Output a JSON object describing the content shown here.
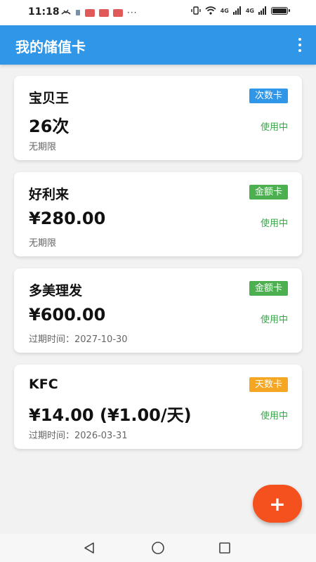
{
  "status_bar": {
    "time": "11:18",
    "left_icons": [
      "phone-missed-icon",
      "small-indicator-icon",
      "app-notification-icon",
      "app-notification-icon",
      "app-notification-icon"
    ],
    "overflow": "···",
    "network_1": "4G",
    "network_2": "4G",
    "battery_level": 0.9
  },
  "app_bar": {
    "title": "我的储值卡",
    "menu_icon": "more-vert-icon",
    "background_color": "#2f96e8"
  },
  "cards": [
    {
      "name": "宝贝王",
      "amount": "26次",
      "expiry": "无期限",
      "badge": "次数卡",
      "badge_color": "#2f96e8",
      "status": "使用中"
    },
    {
      "name": "好利来",
      "amount": "¥280.00",
      "expiry": "无期限",
      "badge": "金额卡",
      "badge_color": "#4caf50",
      "status": "使用中"
    },
    {
      "name": "多美理发",
      "amount": "¥600.00",
      "expiry": "过期时间：2027-10-30",
      "badge": "金额卡",
      "badge_color": "#4caf50",
      "status": "使用中"
    },
    {
      "name": "KFC",
      "amount": "¥14.00 (¥1.00/天)",
      "expiry": "过期时间：2026-03-31",
      "badge": "天数卡",
      "badge_color": "#f5a623",
      "status": "使用中"
    }
  ],
  "fab": {
    "label": "+",
    "icon": "add-icon",
    "color": "#f4511e"
  },
  "nav_bar": {
    "buttons": [
      "back-icon",
      "home-icon",
      "recents-icon"
    ]
  },
  "colors": {
    "status_active": "#3aa64a"
  }
}
